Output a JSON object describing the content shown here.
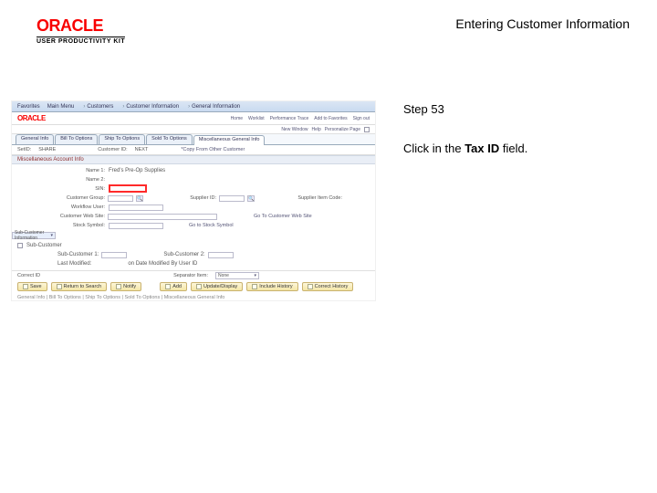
{
  "header": {
    "brand": "ORACLE",
    "subbrand": "USER PRODUCTIVITY KIT",
    "doc_title": "Entering Customer Information"
  },
  "instructions": {
    "step_label": "Step 53",
    "line_pre": "Click in the ",
    "line_bold": "Tax ID",
    "line_post": " field."
  },
  "app": {
    "brand": "ORACLE",
    "nav": {
      "n1": "Favorites",
      "n2": "Main Menu",
      "n3": "Customers",
      "n4": "Customer Information",
      "n5": "General Information"
    },
    "toplinks": {
      "home": "Home",
      "worklist": "Worklist",
      "perf": "Performance Trace",
      "addfav": "Add to Favorites",
      "signout": "Sign out"
    },
    "subbar": {
      "newwin": "New Window",
      "help": "Help",
      "pers": "Personalize Page"
    },
    "tabs": {
      "t1": "General Info",
      "t2": "Bill To Options",
      "t3": "Ship To Options",
      "t4": "Sold To Options",
      "t5": "Miscellaneous General Info"
    },
    "fields": {
      "setid_lbl": "SetID:",
      "setid_val": "SHARE",
      "custid_lbl": "Customer ID:",
      "custid_val": "NEXT",
      "copy_lbl": "*Copy From Other Customer",
      "name1_lbl": "Name 1:",
      "name1_val": "Fred's Pre-Op Supplies",
      "name2_lbl": "Name 2:",
      "sin_lbl": "SIN:",
      "custgrp_lbl": "Customer Group:",
      "supplier_lbl": "Supplier ID:",
      "supplier_set_lbl": "Supplier Item Code:",
      "workflow_lbl": "Workflow User:",
      "websie_lbl": "Customer Web Site:",
      "goweb_lbl": "Go To Customer Web Site",
      "stock_lbl": "Stock Symbol:",
      "stock_link": "Go to Stock Symbol",
      "sub_section": "Sub-Customer Information",
      "subchk_lbl": "Sub-Customer",
      "sub1_lbl": "Sub-Customer 1:",
      "sub2_lbl": "Sub-Customer 2:",
      "lastmod_lbl": "Last Modified:",
      "modby_lbl": "on Date Modified By User ID",
      "correctid_lbl": "Correct ID",
      "sep_lbl": "Separator Item:",
      "sep_val": "None",
      "misc_section": "Miscellaneous Account Info"
    },
    "buttons": {
      "save": "Save",
      "ret": "Return to Search",
      "notify": "Notify",
      "add": "Add",
      "updisp": "Update/Display",
      "inchist": "Include History",
      "corrhist": "Correct History"
    },
    "footer": "General Info | Bill To Options | Ship To Options | Sold To Options | Miscellaneous General Info"
  }
}
